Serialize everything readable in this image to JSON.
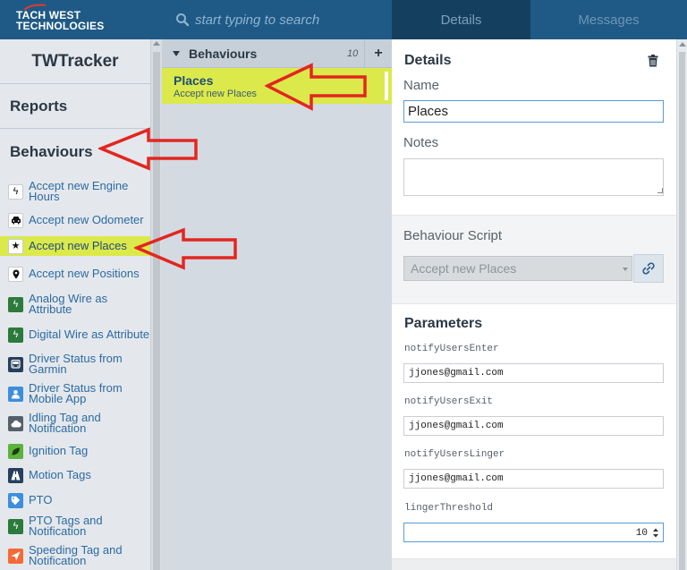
{
  "brand": {
    "line1": "TACH WEST",
    "line2": "TECHNOLOGIES"
  },
  "search": {
    "placeholder": "start typing to search"
  },
  "tabs": [
    {
      "label": "Details",
      "active": true
    },
    {
      "label": "Messages",
      "active": false
    }
  ],
  "sidebar": {
    "app_title": "TWTracker",
    "reports_label": "Reports",
    "behaviours_label": "Behaviours",
    "items": [
      {
        "label": "Accept new Engine Hours",
        "icon": "bolt-icon"
      },
      {
        "label": "Accept new Odometer",
        "icon": "car-icon"
      },
      {
        "label": "Accept new Places",
        "icon": "star-icon",
        "active": true
      },
      {
        "label": "Accept new Positions",
        "icon": "map-pin-icon"
      },
      {
        "label": "Analog Wire as Attribute",
        "icon": "bolt-icon"
      },
      {
        "label": "Digital Wire as Attribute",
        "icon": "bolt-icon"
      },
      {
        "label": "Driver Status from Garmin",
        "icon": "bus-icon"
      },
      {
        "label": "Driver Status from Mobile App",
        "icon": "user-icon"
      },
      {
        "label": "Idling Tag and Notification",
        "icon": "cloud-icon"
      },
      {
        "label": "Ignition Tag",
        "icon": "leaf-icon"
      },
      {
        "label": "Motion Tags",
        "icon": "road-icon"
      },
      {
        "label": "PTO",
        "icon": "tag-icon"
      },
      {
        "label": "PTO Tags and Notification",
        "icon": "bolt-icon"
      },
      {
        "label": "Speeding Tag and Notification",
        "icon": "send-icon"
      }
    ]
  },
  "list": {
    "header_label": "Behaviours",
    "count": "10",
    "add_label": "+",
    "selected": {
      "title": "Places",
      "subtitle": "Accept new Places"
    }
  },
  "details": {
    "title": "Details",
    "name_label": "Name",
    "name_value": "Places",
    "notes_label": "Notes",
    "notes_value": "",
    "script_label": "Behaviour Script",
    "script_value": "Accept new Places",
    "parameters_label": "Parameters",
    "params": [
      {
        "name": "notifyUsersEnter",
        "value": "jjones@gmail.com"
      },
      {
        "name": "notifyUsersExit",
        "value": "jjones@gmail.com"
      },
      {
        "name": "notifyUsersLinger",
        "value": "jjones@gmail.com"
      }
    ],
    "linger_label": "lingerThreshold",
    "linger_value": "10"
  },
  "colors": {
    "topbar": "#1f5a86",
    "highlight": "#dbe94b",
    "link": "#2d6aa2",
    "annotation": "#e3261f"
  }
}
